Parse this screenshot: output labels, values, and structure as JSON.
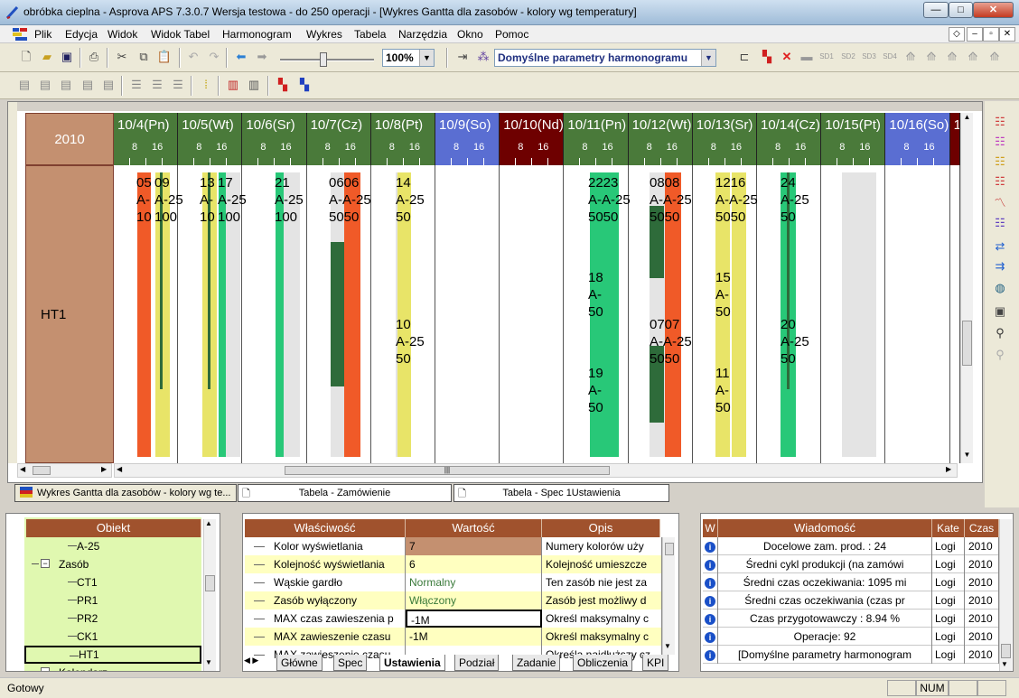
{
  "window": {
    "title": "obróbka cieplna - Asprova APS 7.3.0.7 Wersja testowa  - do 250 operacji - [Wykres Gantta dla zasobów - kolory wg temperatury]"
  },
  "menu": [
    "Plik",
    "Edycja",
    "Widok",
    "Widok Tabel",
    "Harmonogram",
    "Wykres",
    "Tabela",
    "Narzędzia",
    "Okno",
    "Pomoc"
  ],
  "toolbar": {
    "zoom": "100%",
    "params": "Domyślne parametry harmonogramu",
    "sd": [
      "SD1",
      "SD2",
      "SD3",
      "SD4"
    ]
  },
  "gantt": {
    "year": "2010",
    "resource": "HT1",
    "hours": [
      "8",
      "16"
    ],
    "days": [
      {
        "label": "10/4(Pn)",
        "kind": "work"
      },
      {
        "label": "10/5(Wt)",
        "kind": "work"
      },
      {
        "label": "10/6(Sr)",
        "kind": "work"
      },
      {
        "label": "10/7(Cz)",
        "kind": "work"
      },
      {
        "label": "10/8(Pt)",
        "kind": "work"
      },
      {
        "label": "10/9(So)",
        "kind": "sat"
      },
      {
        "label": "10/10(Nd)",
        "kind": "sun"
      },
      {
        "label": "10/11(Pn)",
        "kind": "work"
      },
      {
        "label": "10/12(Wt)",
        "kind": "work"
      },
      {
        "label": "10/13(Sr)",
        "kind": "work"
      },
      {
        "label": "10/14(Cz)",
        "kind": "work"
      },
      {
        "label": "10/15(Pt)",
        "kind": "work"
      },
      {
        "label": "10/16(So)",
        "kind": "sat"
      },
      {
        "label": "1",
        "kind": "sun"
      }
    ],
    "labels": [
      {
        "id": "l1",
        "text": "05\nA-\n10"
      },
      {
        "id": "l2",
        "text": "09\nA-25\n100"
      },
      {
        "id": "l3",
        "text": "13\nA-\n10"
      },
      {
        "id": "l4",
        "text": "17\nA-25\n100"
      },
      {
        "id": "l5",
        "text": "21\nA-25\n100"
      },
      {
        "id": "l6",
        "text": "0606\nA-A-25\n5050"
      },
      {
        "id": "l7",
        "text": "14\nA-25\n50"
      },
      {
        "id": "l8",
        "text": "10\nA-25\n50"
      },
      {
        "id": "l9",
        "text": "2223\nA-A-25\n5050"
      },
      {
        "id": "l10",
        "text": "18\nA-\n50"
      },
      {
        "id": "l11",
        "text": "19\nA-\n50"
      },
      {
        "id": "l12",
        "text": "0808\nA-A-25\n5050"
      },
      {
        "id": "l13",
        "text": "0707\nA-A-25\n5050"
      },
      {
        "id": "l14",
        "text": "1216\nA-A-25\n5050"
      },
      {
        "id": "l15",
        "text": "15\nA-\n50"
      },
      {
        "id": "l16",
        "text": "11\nA-\n50"
      },
      {
        "id": "l17",
        "text": "24\nA-25\n50"
      },
      {
        "id": "l18",
        "text": "20\nA-25\n50"
      }
    ]
  },
  "doc_tabs": [
    "Wykres Gantta dla zasobów - kolory wg te...",
    "Tabela - Zamówienie",
    "Tabela - Spec 1Ustawienia"
  ],
  "tree": {
    "header": "Obiekt",
    "rows": [
      "A-25",
      "Zasób",
      "CT1",
      "PR1",
      "PR2",
      "CK1",
      "HT1",
      "Kalendarz"
    ]
  },
  "props": {
    "headers": [
      "Właściwość",
      "Wartość",
      "Opis"
    ],
    "rows": [
      [
        "Kolor wyświetlania",
        "7",
        "Numery kolorów uży"
      ],
      [
        "Kolejność wyświetlania",
        "6",
        "Kolejność umieszcze"
      ],
      [
        "Wąskie gardło",
        "Normalny",
        "Ten zasób nie jest za"
      ],
      [
        "Zasób wyłączony",
        "Włączony",
        "Zasób jest możliwy d"
      ],
      [
        "MAX czas zawieszenia p",
        "-1M",
        "Określ maksymalny c"
      ],
      [
        "MAX zawieszenie czasu",
        "-1M",
        "Określ maksymalny c"
      ],
      [
        "MAX zawieszenie czasu",
        "",
        "Określa najdłuższy cz"
      ]
    ],
    "tabs": [
      "Główne",
      "Spec",
      "Ustawienia",
      "Podział",
      "Zadanie",
      "Obliczenia",
      "KPI"
    ]
  },
  "messages": {
    "headers": [
      "W",
      "Wiadomość",
      "Kate",
      "Czas"
    ],
    "rows": [
      [
        "Docelowe zam. prod. : 24",
        "Logi",
        "2010"
      ],
      [
        "Średni cykl produkcji (na zamówi",
        "Logi",
        "2010"
      ],
      [
        "Średni czas oczekiwania: 1095 mi",
        "Logi",
        "2010"
      ],
      [
        "Średni czas oczekiwania (czas pr",
        "Logi",
        "2010"
      ],
      [
        "Czas przygotowawczy : 8.94 %",
        "Logi",
        "2010"
      ],
      [
        "Operacje: 92",
        "Logi",
        "2010"
      ],
      [
        "[Domyślne parametry harmonogram",
        "Logi",
        "2010"
      ]
    ]
  },
  "status": {
    "left": "Gotowy",
    "num": "NUM"
  },
  "colors": {
    "work": "#4a7a3a",
    "sat": "#5a6ed2",
    "sun": "#6e0000",
    "orange": "#f05a28",
    "yellow": "#e8e468",
    "green": "#28c878",
    "dkgreen": "#2e6b3a",
    "gray": "#e4e4e4",
    "resource": "#c49070"
  }
}
